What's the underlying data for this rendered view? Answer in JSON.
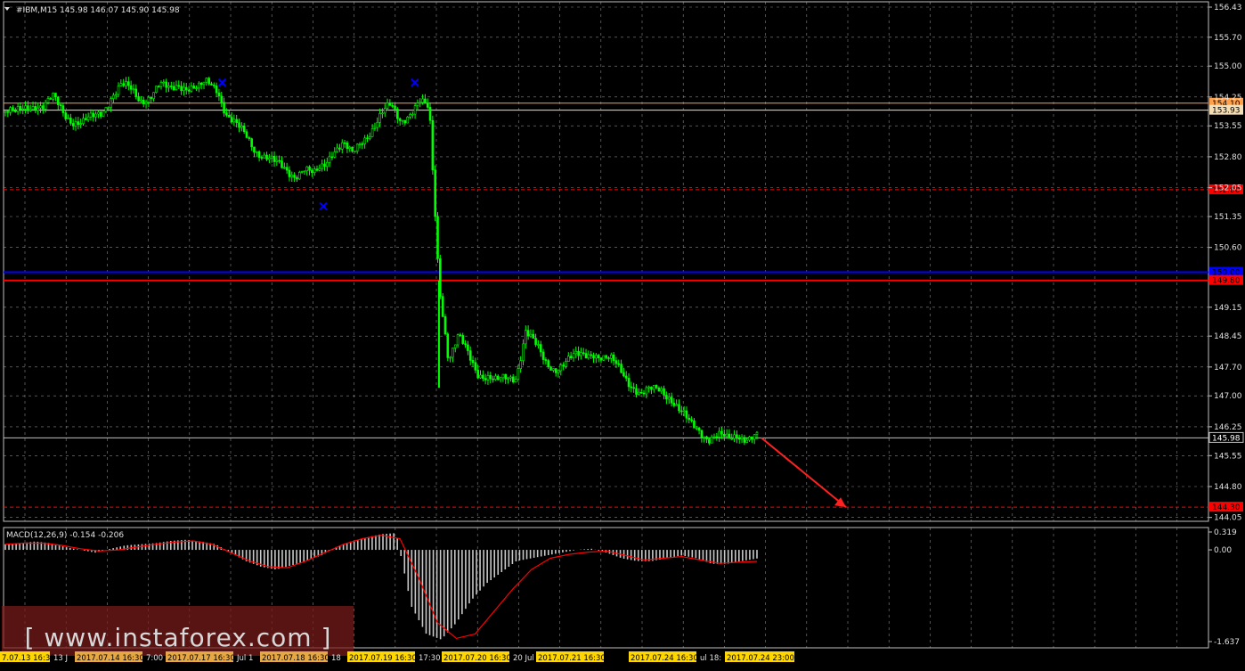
{
  "header": {
    "symbol_info": "#IBM,M15  145.98 146.07 145.90 145.98"
  },
  "macd": {
    "label": "MACD(12,26,9) -0.154 -0.206"
  },
  "watermark": {
    "text": "[ www.instaforex.com ]"
  },
  "colors": {
    "background": "#000000",
    "grid": "#c0c0c0",
    "candle": "#00ff00",
    "resistance_light": "#f5deb3",
    "resistance_orange": "#ffa04c",
    "red_level": "#ff0000",
    "blue_level": "#0000ff",
    "arrow": "#ff2020",
    "macd_hist": "#c8c8c8",
    "macd_signal": "#ff0000",
    "watermark_bg": "#7a1a1a",
    "time_highlight": "#ffd700",
    "time_highlight_alt": "#e6a845"
  },
  "chart_data": [
    {
      "type": "candlestick",
      "title": "#IBM,M15",
      "ylim": [
        144.0,
        156.43
      ],
      "price_axis_ticks": [
        "156.43",
        "155.70",
        "155.00",
        "154.25",
        "153.55",
        "152.80",
        "152.05",
        "151.35",
        "150.60",
        "149.15",
        "148.45",
        "147.70",
        "147.00",
        "146.25",
        "145.55",
        "144.80",
        "144.05"
      ],
      "levels": [
        {
          "name": "resistance upper",
          "value": 154.1,
          "label": "154.10",
          "style": "solid",
          "color": "#ffa04c"
        },
        {
          "name": "resistance lower",
          "value": 153.93,
          "label": "153.93",
          "style": "solid",
          "color": "#f5deb3"
        },
        {
          "name": "red dashed upper",
          "value": 152.0,
          "label": "152.00",
          "style": "dashed",
          "color": "#ff0000"
        },
        {
          "name": "blue level",
          "value": 150.0,
          "label": "150.00",
          "style": "solid",
          "color": "#0000ff"
        },
        {
          "name": "red level",
          "value": 149.8,
          "label": "149.80",
          "style": "solid",
          "color": "#ff0000"
        },
        {
          "name": "current price",
          "value": 145.98,
          "label": "145.98",
          "style": "solid",
          "color": "#c0c0c0"
        },
        {
          "name": "red dashed lower",
          "value": 144.3,
          "label": "144.30",
          "style": "dashed",
          "color": "#ff0000"
        }
      ],
      "close_path": [
        153.9,
        153.8,
        154.0,
        154.1,
        154.0,
        154.2,
        153.9,
        153.7,
        153.6,
        153.7,
        153.9,
        154.3,
        154.5,
        154.4,
        154.2,
        154.3,
        154.5,
        154.4,
        154.6,
        154.5,
        154.4,
        154.6,
        154.5,
        153.8,
        153.5,
        153.3,
        153.0,
        152.8,
        152.6,
        152.5,
        152.4,
        152.5,
        152.3,
        152.6,
        153.0,
        153.1,
        152.8,
        153.2,
        153.5,
        153.8,
        154.0,
        153.7,
        153.9,
        154.1,
        153.9,
        149.8,
        147.9,
        148.4,
        148.0,
        147.6,
        147.5,
        147.3,
        147.4,
        147.5,
        148.6,
        148.2,
        147.8,
        147.7,
        147.8,
        147.9,
        148.0,
        148.1,
        147.9,
        147.8,
        147.6,
        147.3,
        147.0,
        147.1,
        147.2,
        147.0,
        146.6,
        146.3,
        146.2,
        146.0,
        146.0,
        145.9,
        146.1,
        146.0,
        145.98
      ],
      "markers": [
        {
          "name": "blue x high 1",
          "price": 154.6
        },
        {
          "name": "blue x low",
          "price": 151.6
        },
        {
          "name": "blue x high 2",
          "price": 154.6
        }
      ],
      "forecast_arrow": {
        "from": 145.98,
        "to": 144.3
      }
    },
    {
      "type": "bar",
      "title": "MACD(12,26,9) -0.154 -0.206",
      "ylim": [
        -1.637,
        0.319
      ],
      "axis_ticks": [
        "0.319",
        "0.00",
        "-1.637"
      ],
      "histogram_path": [
        0.1,
        0.12,
        0.15,
        0.12,
        0.05,
        0.0,
        -0.05,
        0.02,
        0.08,
        0.1,
        0.12,
        0.16,
        0.18,
        0.15,
        0.1,
        -0.05,
        -0.2,
        -0.3,
        -0.35,
        -0.28,
        -0.2,
        -0.1,
        0.05,
        0.15,
        0.22,
        0.28,
        0.3,
        -1.0,
        -1.5,
        -1.6,
        -1.3,
        -0.9,
        -0.6,
        -0.4,
        -0.2,
        -0.15,
        -0.1,
        -0.05,
        0.0,
        0.02,
        -0.05,
        -0.15,
        -0.2,
        -0.2,
        -0.15,
        -0.1,
        -0.15,
        -0.25,
        -0.25,
        -0.2,
        -0.154
      ],
      "signal_path": [
        0.1,
        0.12,
        0.12,
        0.08,
        0.02,
        -0.02,
        0.0,
        0.05,
        0.1,
        0.14,
        0.16,
        0.1,
        -0.05,
        -0.2,
        -0.3,
        -0.32,
        -0.2,
        -0.05,
        0.1,
        0.2,
        0.26,
        0.2,
        -0.5,
        -1.3,
        -1.58,
        -1.5,
        -1.1,
        -0.7,
        -0.35,
        -0.15,
        -0.08,
        -0.04,
        -0.02,
        -0.1,
        -0.18,
        -0.15,
        -0.12,
        -0.18,
        -0.24,
        -0.22,
        -0.206
      ]
    }
  ],
  "time_axis": [
    {
      "text": "7.07.13 16:30",
      "hl": "yellow",
      "w": 58
    },
    {
      "text": "13 J",
      "hl": "none",
      "w": 26
    },
    {
      "text": "2017.07.14 16:30",
      "hl": "orange",
      "w": 78
    },
    {
      "text": "7:00",
      "hl": "none",
      "w": 24
    },
    {
      "text": "2017.07.17 16:30",
      "hl": "orange",
      "w": 78
    },
    {
      "text": "Jul 1",
      "hl": "none",
      "w": 28
    },
    {
      "text": "2017.07.18 16:30",
      "hl": "orange",
      "w": 78
    },
    {
      "text": "18",
      "hl": "none",
      "w": 20
    },
    {
      "text": "2017.07.19 16:30",
      "hl": "yellow",
      "w": 78
    },
    {
      "text": "17:30",
      "hl": "none",
      "w": 28
    },
    {
      "text": "2017.07.20 16:30",
      "hl": "yellow",
      "w": 78
    },
    {
      "text": "20 Jul",
      "hl": "none",
      "w": 28
    },
    {
      "text": "2017.07.21 16:30",
      "hl": "yellow",
      "w": 78
    },
    {
      "text": "",
      "hl": "none",
      "w": 26
    },
    {
      "text": "2017.07.24 16:30",
      "hl": "yellow",
      "w": 78
    },
    {
      "text": "ul 18:",
      "hl": "none",
      "w": 30
    },
    {
      "text": "2017.07.24 23:00",
      "hl": "yellow",
      "w": 80
    }
  ]
}
